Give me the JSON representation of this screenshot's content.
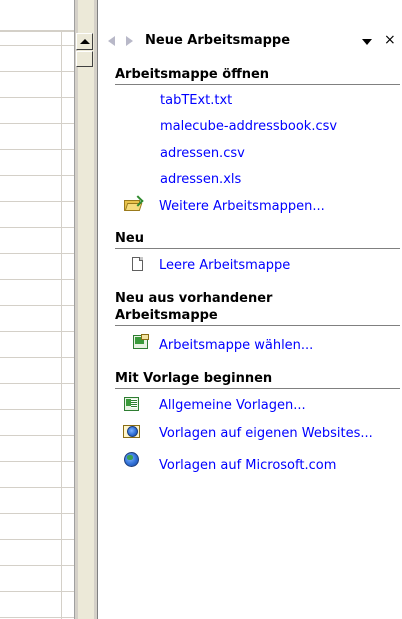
{
  "task_pane": {
    "title": "Neue Arbeitsmappe",
    "close_glyph": "×",
    "sections": {
      "open": {
        "heading": "Arbeitsmappe öffnen",
        "files": [
          "tabTExt.txt",
          "malecube-addressbook.csv",
          "adressen.csv",
          "adressen.xls"
        ],
        "more": {
          "label": "Weitere Arbeitsmappen...",
          "icon": "open-folder-icon"
        }
      },
      "new": {
        "heading": "Neu",
        "blank": {
          "label": "Leere Arbeitsmappe",
          "icon": "blank-document-icon"
        }
      },
      "from_existing": {
        "heading_line1": "Neu aus vorhandener",
        "heading_line2": "Arbeitsmappe",
        "choose": {
          "label": "Arbeitsmappe wählen...",
          "icon": "workbook-icon"
        }
      },
      "template": {
        "heading": "Mit Vorlage beginnen",
        "items": [
          {
            "label": "Allgemeine Vorlagen...",
            "icon": "spreadsheet-template-icon"
          },
          {
            "label": "Vorlagen auf eigenen Websites...",
            "icon": "web-folder-icon"
          },
          {
            "label": "Vorlagen auf Microsoft.com",
            "icon": "globe-icon"
          }
        ]
      }
    }
  },
  "colors": {
    "link": "#0000ff",
    "heading_rule": "#808080",
    "grid_line": "#d4d0c8",
    "scrollbar": "#ece9d8"
  }
}
